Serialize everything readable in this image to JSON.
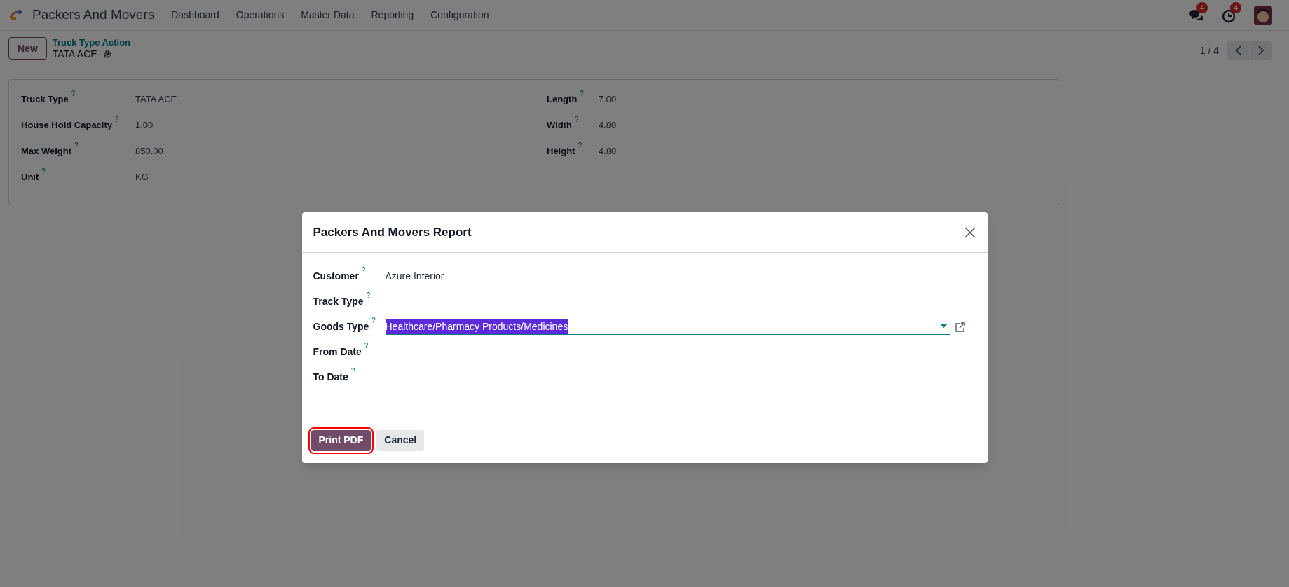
{
  "navbar": {
    "app_name": "Packers And Movers",
    "menu": [
      "Dashboard",
      "Operations",
      "Master Data",
      "Reporting",
      "Configuration"
    ],
    "messages_count": "4",
    "activities_count": "4"
  },
  "control_panel": {
    "new_button": "New",
    "breadcrumb": "Truck Type Action",
    "record_name": "TATA ACE",
    "pager": "1 / 4"
  },
  "form": {
    "left": [
      {
        "label": "Truck Type",
        "help": "?",
        "value": "TATA ACE"
      },
      {
        "label": "House Hold Capacity",
        "help": "?",
        "value": "1.00"
      },
      {
        "label": "Max Weight",
        "help": "?",
        "value": "850.00"
      },
      {
        "label": "Unit",
        "help": "?",
        "value": "KG"
      }
    ],
    "right": [
      {
        "label": "Length",
        "help": "?",
        "value": "7.00"
      },
      {
        "label": "Width",
        "help": "?",
        "value": "4.80"
      },
      {
        "label": "Height",
        "help": "?",
        "value": "4.80"
      }
    ]
  },
  "dialog": {
    "title": "Packers And Movers Report",
    "fields": [
      {
        "kind": "text",
        "label": "Customer",
        "help": "?",
        "value": "Azure Interior"
      },
      {
        "kind": "text",
        "label": "Track Type",
        "help": "?"
      },
      {
        "kind": "many2one",
        "label": "Goods Type",
        "help": "?",
        "value": "Healthcare/Pharmacy Products/Medicines",
        "text_selected": true
      },
      {
        "kind": "text",
        "label": "From Date",
        "help": "?"
      },
      {
        "kind": "text",
        "label": "To Date",
        "help": "?"
      }
    ],
    "buttons": [
      {
        "label": "Print PDF",
        "kind": "primary",
        "highlighted": true
      },
      {
        "label": "Cancel",
        "kind": "secondary",
        "highlighted": false
      }
    ]
  }
}
